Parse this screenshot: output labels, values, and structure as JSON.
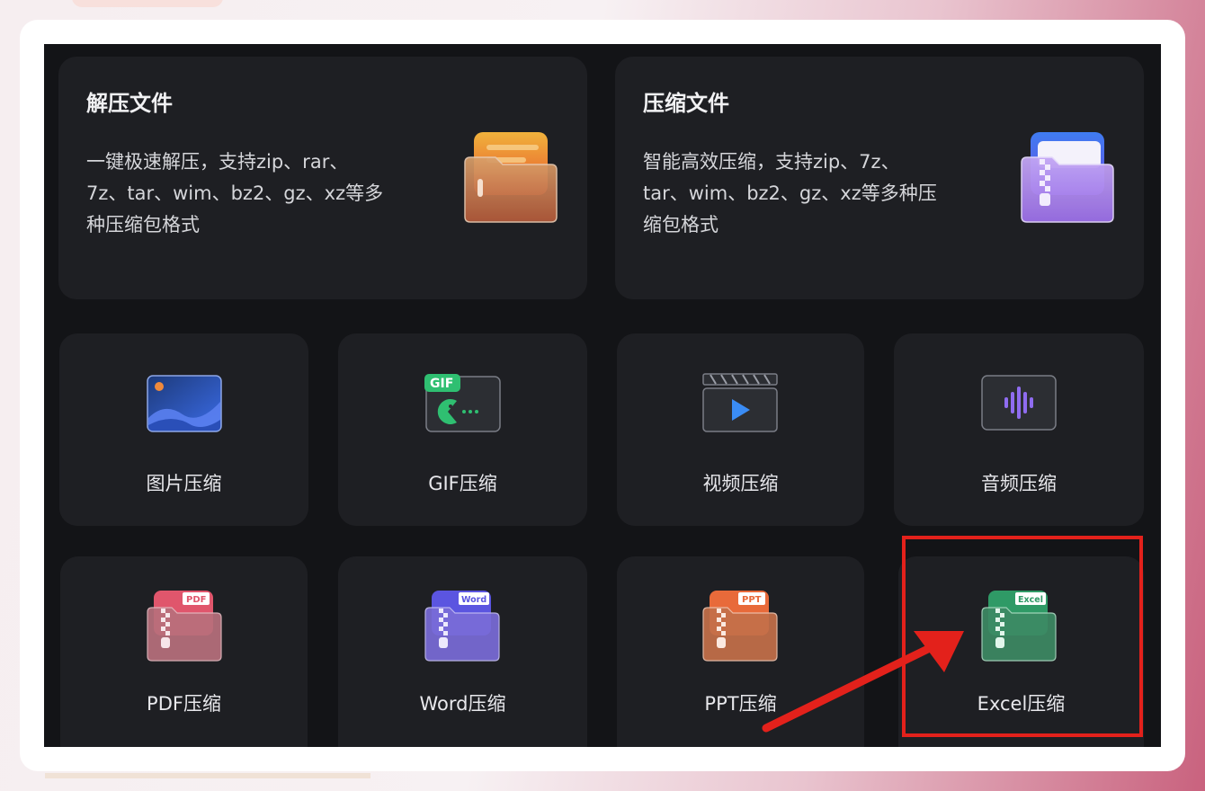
{
  "cards_large": [
    {
      "title": "解压文件",
      "desc_lines": [
        "一键极速解压，支持zip、rar、",
        "7z、tar、wim、bz2、gz、xz等多",
        "种压缩包格式"
      ]
    },
    {
      "title": "压缩文件",
      "desc_lines": [
        "智能高效压缩，支持zip、7z、",
        "tar、wim、bz2、gz、xz等多种压",
        "缩包格式"
      ]
    }
  ],
  "tools": [
    {
      "label": "图片压缩",
      "icon": "image-icon"
    },
    {
      "label": "GIF压缩",
      "icon": "gif-icon",
      "icon_text": "GIF"
    },
    {
      "label": "视频压缩",
      "icon": "video-clapper-icon"
    },
    {
      "label": "音频压缩",
      "icon": "audio-wave-icon"
    },
    {
      "label": "PDF压缩",
      "icon": "pdf-zip-folder-icon",
      "tag": "PDF"
    },
    {
      "label": "Word压缩",
      "icon": "word-zip-folder-icon",
      "tag": "Word"
    },
    {
      "label": "PPT压缩",
      "icon": "ppt-zip-folder-icon",
      "tag": "PPT"
    },
    {
      "label": "Excel压缩",
      "icon": "excel-zip-folder-icon",
      "tag": "Excel"
    }
  ],
  "colors": {
    "background": "#131417",
    "card": "#1e1f23",
    "annotation": "#e3211b",
    "unzip_accent": "#f08a3c",
    "zip_accent": "#8f6cf0",
    "pdf": "#e0566c",
    "word": "#5b55e0",
    "ppt": "#e86a3a",
    "excel": "#2f9a66"
  }
}
